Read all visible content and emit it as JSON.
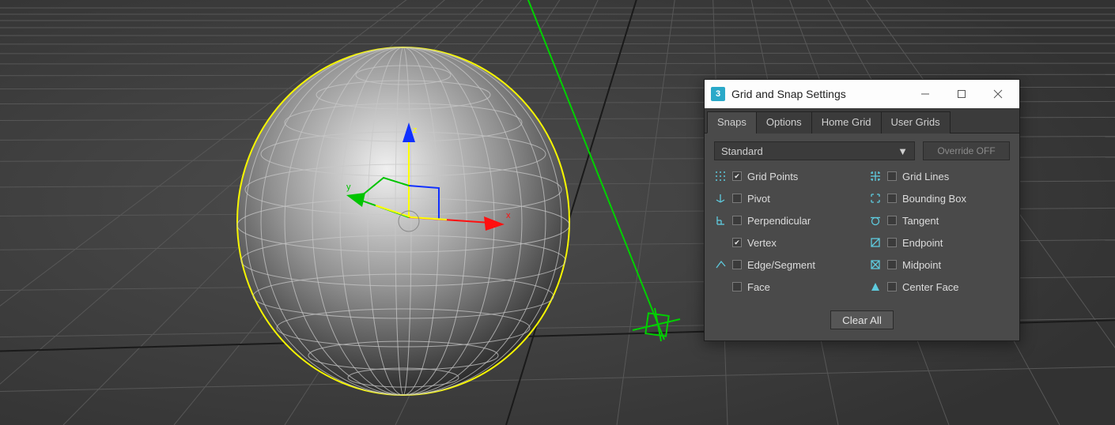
{
  "dialog": {
    "title": "Grid and Snap Settings",
    "tabs": [
      "Snaps",
      "Options",
      "Home Grid",
      "User Grids"
    ],
    "active_tab": 0,
    "dropdown_value": "Standard",
    "override_label": "Override OFF",
    "snaps_left": [
      {
        "icon": "grid-points-icon",
        "label": "Grid Points",
        "checked": true
      },
      {
        "icon": "pivot-icon",
        "label": "Pivot",
        "checked": false
      },
      {
        "icon": "perpendicular-icon",
        "label": "Perpendicular",
        "checked": false
      },
      {
        "icon": "vertex-icon",
        "label": "Vertex",
        "checked": true
      },
      {
        "icon": "edge-segment-icon",
        "label": "Edge/Segment",
        "checked": false
      },
      {
        "icon": "face-icon",
        "label": "Face",
        "checked": false
      }
    ],
    "snaps_right": [
      {
        "icon": "grid-lines-icon",
        "label": "Grid Lines",
        "checked": false
      },
      {
        "icon": "bounding-box-icon",
        "label": "Bounding Box",
        "checked": false
      },
      {
        "icon": "tangent-icon",
        "label": "Tangent",
        "checked": false
      },
      {
        "icon": "endpoint-icon",
        "label": "Endpoint",
        "checked": false
      },
      {
        "icon": "midpoint-icon",
        "label": "Midpoint",
        "checked": false
      },
      {
        "icon": "center-face-icon",
        "label": "Center Face",
        "checked": false
      }
    ],
    "clear_label": "Clear All"
  },
  "axes": {
    "x": "x",
    "y": "y",
    "z": "z"
  }
}
